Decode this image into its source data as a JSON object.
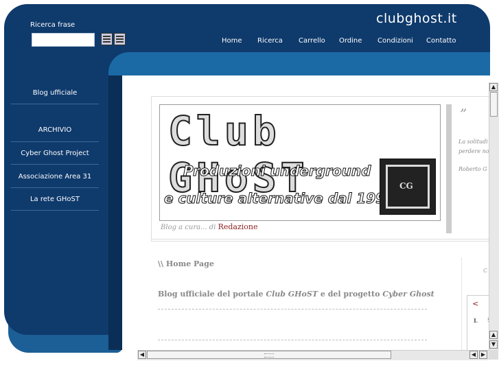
{
  "header": {
    "logo": "clubghost.it",
    "search_label": "Ricerca frase",
    "nav": [
      "Home",
      "Ricerca",
      "Carrello",
      "Ordine",
      "Condizioni",
      "Contatto"
    ]
  },
  "sidebar": {
    "items": [
      "Blog ufficiale",
      "ARCHIVIO",
      "Cyber Ghost Project",
      "Associazione Area 31",
      "La rete GHoST"
    ]
  },
  "banner": {
    "title": "Club GHoST",
    "line1": "Produzioni underground",
    "line2": "e culture alternative dal 1994",
    "seal_text": "CG"
  },
  "credit": {
    "prefix": "Blog a cura...",
    "by": "di",
    "author": "Redazione"
  },
  "quote": {
    "mark": "”",
    "line1": "La solitudi",
    "line2": "perdere no",
    "author": "Roberto G"
  },
  "main": {
    "breadcrumb": "\\\\ Home Page",
    "post_prefix": "Blog ufficiale del portale",
    "post_em1": "Club GHoST",
    "post_mid": "e del progetto",
    "post_em2": "Cyber Ghost"
  },
  "side_panel": {
    "c_text": "C",
    "arrow": "<",
    "l_text": "L",
    "s_text": "S"
  },
  "colors": {
    "frame": "#0f3a6c",
    "accent_bar": "#1b6aa5",
    "link": "#8b1e1e"
  }
}
